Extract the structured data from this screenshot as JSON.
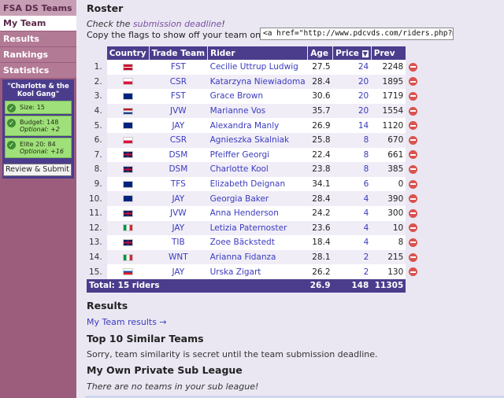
{
  "sidebar": {
    "header": "FSA DS Teams",
    "items": [
      {
        "label": "My Team",
        "active": true
      },
      {
        "label": "Results"
      },
      {
        "label": "Rankings"
      },
      {
        "label": "Statistics"
      }
    ],
    "team_box": {
      "name": "\"Charlotte & the Kool Gang\"",
      "stats": [
        {
          "line1": "Size: 15",
          "line2": ""
        },
        {
          "line1": "Budget: 148",
          "line2": "Optional: +2"
        },
        {
          "line1": "Elite 20: 84",
          "line2": "Optional: +16"
        }
      ],
      "review_label": "Review & Submit"
    }
  },
  "main": {
    "roster_title": "Roster",
    "deadline_prefix": "Check the ",
    "deadline_link": "submission deadline",
    "deadline_suffix": "!",
    "flags_label": "Copy the flags to show off your team on PdC:",
    "flags_value": "<a href=\"http://www.pdcvds.com/riders.php?mw=",
    "columns": [
      "Country",
      "Trade Team",
      "Rider",
      "Age",
      "Price",
      "Prev"
    ],
    "sort_indicator": "▼",
    "riders": [
      {
        "n": "1.",
        "flag": "DEN",
        "team": "FST",
        "rider": "Cecilie Uttrup Ludwig",
        "age": "27.5",
        "price": "24",
        "prev": "2248"
      },
      {
        "n": "2.",
        "flag": "POL",
        "team": "CSR",
        "rider": "Katarzyna Niewiadoma",
        "age": "28.4",
        "price": "20",
        "prev": "1895"
      },
      {
        "n": "3.",
        "flag": "NZL",
        "team": "FST",
        "rider": "Grace Brown",
        "age": "30.6",
        "price": "20",
        "prev": "1719"
      },
      {
        "n": "4.",
        "flag": "NED",
        "team": "JVW",
        "rider": "Marianne Vos",
        "age": "35.7",
        "price": "20",
        "prev": "1554"
      },
      {
        "n": "5.",
        "flag": "AUS",
        "team": "JAY",
        "rider": "Alexandra Manly",
        "age": "26.9",
        "price": "14",
        "prev": "1120"
      },
      {
        "n": "6.",
        "flag": "POL",
        "team": "CSR",
        "rider": "Agnieszka Skalniak",
        "age": "25.8",
        "price": "8",
        "prev": "670"
      },
      {
        "n": "7.",
        "flag": "GBR",
        "team": "DSM",
        "rider": "Pfeiffer Georgi",
        "age": "22.4",
        "price": "8",
        "prev": "661"
      },
      {
        "n": "8.",
        "flag": "GBR",
        "team": "DSM",
        "rider": "Charlotte Kool",
        "age": "23.8",
        "price": "8",
        "prev": "385"
      },
      {
        "n": "9.",
        "flag": "AUS",
        "team": "TFS",
        "rider": "Elizabeth Deignan",
        "age": "34.1",
        "price": "6",
        "prev": "0"
      },
      {
        "n": "10.",
        "flag": "NZL",
        "team": "JAY",
        "rider": "Georgia Baker",
        "age": "28.4",
        "price": "4",
        "prev": "390"
      },
      {
        "n": "11.",
        "flag": "GBR",
        "team": "JVW",
        "rider": "Anna Henderson",
        "age": "24.2",
        "price": "4",
        "prev": "300"
      },
      {
        "n": "12.",
        "flag": "ITA",
        "team": "JAY",
        "rider": "Letizia Paternoster",
        "age": "23.6",
        "price": "4",
        "prev": "10"
      },
      {
        "n": "13.",
        "flag": "GBR",
        "team": "TIB",
        "rider": "Zoee Bäckstedt",
        "age": "18.4",
        "price": "4",
        "prev": "8"
      },
      {
        "n": "14.",
        "flag": "ITA",
        "team": "WNT",
        "rider": "Arianna Fidanza",
        "age": "28.1",
        "price": "2",
        "prev": "215"
      },
      {
        "n": "15.",
        "flag": "SVK",
        "team": "JAY",
        "rider": "Urska Zigart",
        "age": "26.2",
        "price": "2",
        "prev": "130"
      }
    ],
    "total": {
      "label": "Total: 15 riders",
      "age": "26.9",
      "price": "148",
      "prev": "11305"
    },
    "results_title": "Results",
    "results_link": "My Team results →",
    "similar_title": "Top 10 Similar Teams",
    "similar_text": "Sorry, team similarity is secret until the team submission deadline.",
    "own_title": "My Own Private Sub League",
    "own_text": "There are no teams in your sub league!"
  },
  "colors": {
    "sidebar": "#9c5d7d",
    "header_purple": "#4b3d8c",
    "link_blue": "#3b3bbf",
    "remove_red": "#d9534f",
    "stat_green": "#9fe07a"
  },
  "icons": {
    "remove": "remove-circle-icon",
    "check": "check-circle-icon"
  }
}
